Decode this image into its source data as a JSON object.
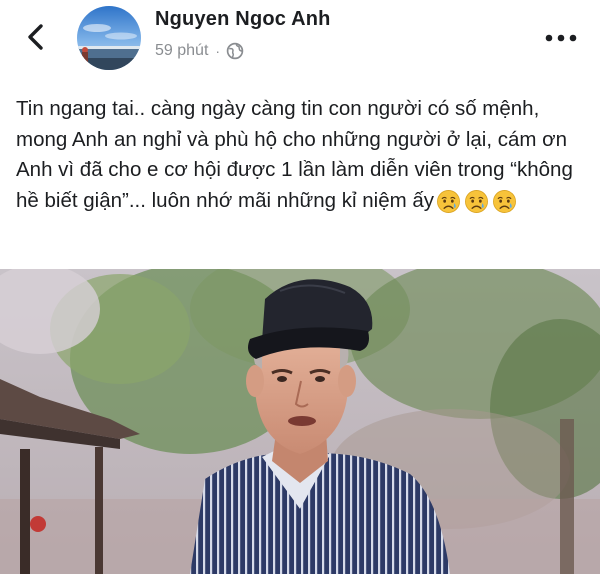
{
  "post": {
    "author": "Nguyen Ngoc Anh",
    "time": "59 phút",
    "separator": "·",
    "privacy_icon": "globe-icon",
    "text": "Tin ngang tai.. càng ngày càng tin con người có số mệnh, mong Anh an nghỉ và phù hộ cho những người ở lại, cám ơn Anh vì đã cho e cơ hội được 1 lần làm diễn viên trong “không hề biết giận”... luôn nhớ mãi những kỉ niệm ấy",
    "emojis": [
      "crying-face-icon",
      "crying-face-icon",
      "crying-face-icon"
    ]
  },
  "icons": {
    "back": "chevron-left-icon",
    "more": "more-dots-icon"
  },
  "colors": {
    "name_text": "#1c1e21",
    "meta_text": "#8a8d91",
    "body_text": "#1c1e21",
    "emoji_face": "#f7c33a",
    "tear": "#5aa9e6"
  }
}
